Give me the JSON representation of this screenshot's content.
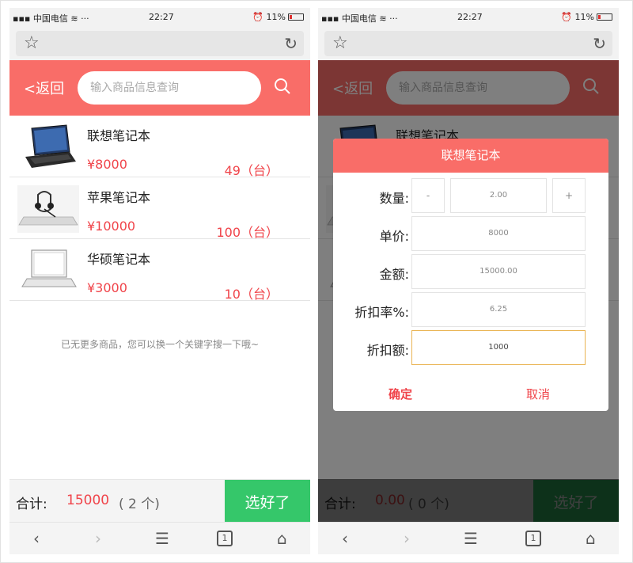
{
  "status_bar": {
    "carrier": "中国电信",
    "time": "22:27",
    "battery": "11%"
  },
  "header": {
    "back_label": "<返回",
    "search_placeholder": "输入商品信息查询"
  },
  "products": [
    {
      "name": "联想笔记本",
      "price": "¥8000",
      "quantity": "49（台）"
    },
    {
      "name": "苹果笔记本",
      "price": "¥10000",
      "quantity": "100（台）"
    },
    {
      "name": "华硕笔记本",
      "price": "¥3000",
      "quantity": "10（台）"
    }
  ],
  "no_more_text": "已无更多商品，您可以换一个关键字搜一下哦~",
  "left_summary": {
    "label": "合计:",
    "amount": "15000",
    "count": "( 2 个)"
  },
  "right_summary": {
    "label": "合计:",
    "amount": "0.00",
    "count": "( 0 个)"
  },
  "confirm_button": "选好了",
  "nav": {
    "back": "‹",
    "forward": "›",
    "menu": "☰",
    "tabs": "1",
    "home": "⌂"
  },
  "dialog": {
    "title": "联想笔记本",
    "quantity_label": "数量:",
    "decrement": "-",
    "quantity_value": "2.00",
    "increment": "+",
    "unit_price_label": "单价:",
    "unit_price_value": "8000",
    "amount_label": "金额:",
    "amount_value": "15000.00",
    "discount_rate_label": "折扣率%:",
    "discount_rate_value": "6.25",
    "discount_amount_label": "折扣额:",
    "discount_amount_value": "1000",
    "ok_label": "确定",
    "cancel_label": "取消"
  },
  "colors": {
    "accent": "#f96d68",
    "price": "#f0444a",
    "confirm": "#35c76a"
  }
}
